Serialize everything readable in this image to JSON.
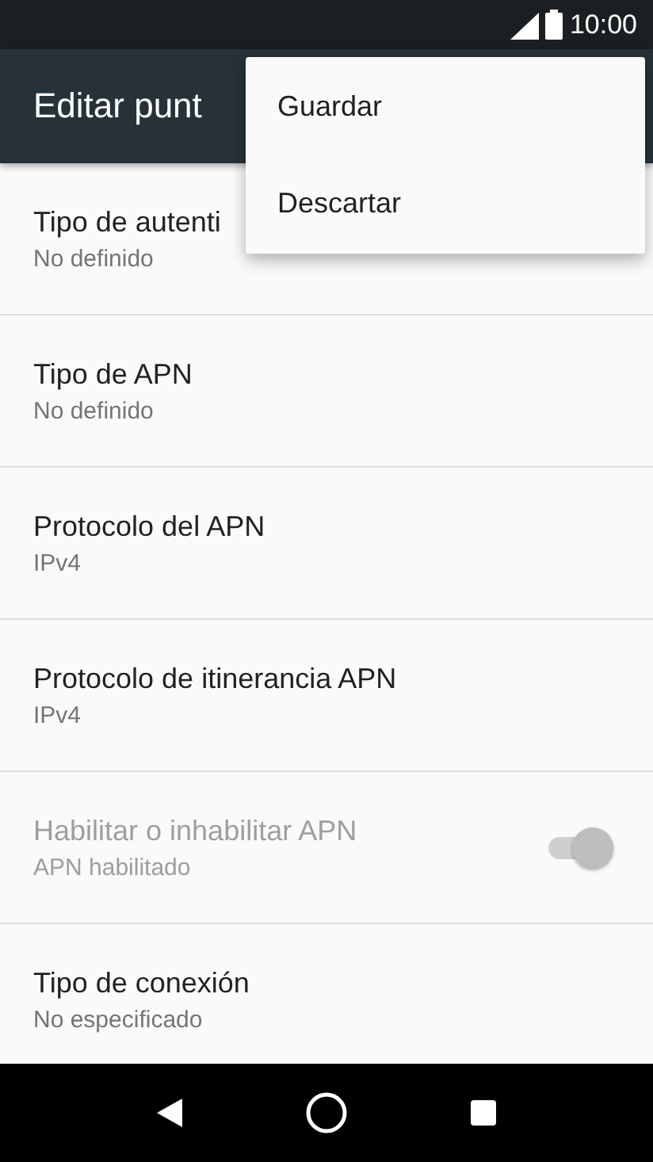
{
  "status_bar": {
    "time": "10:00"
  },
  "toolbar": {
    "title": "Editar punt"
  },
  "menu": {
    "items": [
      {
        "label": "Guardar"
      },
      {
        "label": "Descartar"
      }
    ]
  },
  "rows": [
    {
      "kind": "text",
      "title": "Tipo de autenti",
      "summary": "No definido",
      "disabled": false
    },
    {
      "kind": "text",
      "title": "Tipo de APN",
      "summary": "No definido",
      "disabled": false
    },
    {
      "kind": "text",
      "title": "Protocolo del APN",
      "summary": "IPv4",
      "disabled": false
    },
    {
      "kind": "text",
      "title": "Protocolo de itinerancia APN",
      "summary": "IPv4",
      "disabled": false
    },
    {
      "kind": "switch",
      "title": "Habilitar o inhabilitar APN",
      "summary": "APN habilitado",
      "disabled": true,
      "on": true
    },
    {
      "kind": "text",
      "title": "Tipo de conexión",
      "summary": "No especificado",
      "disabled": false
    }
  ]
}
